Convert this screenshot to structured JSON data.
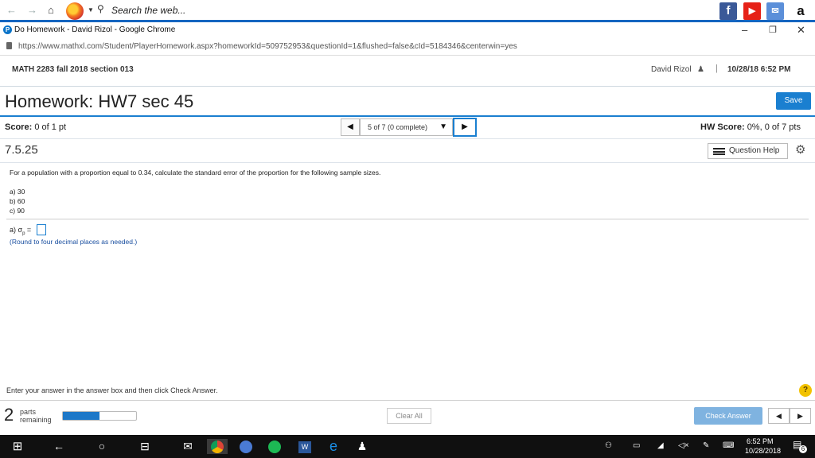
{
  "browser": {
    "search_placeholder": "Search the web...",
    "window_title": "Do Homework - David Rizol - Google Chrome",
    "url": "https://www.mathxl.com/Student/PlayerHomework.aspx?homeworkId=509752953&questionId=1&flushed=false&cId=5184346&centerwin=yes",
    "win_minimize": "–",
    "win_restore": "❐",
    "win_close": "✕"
  },
  "course": {
    "name": "MATH 2283 fall 2018 section 013",
    "user": "David Rizol",
    "separator": "|",
    "datetime": "10/28/18 6:52 PM"
  },
  "homework": {
    "title": "Homework: HW7 sec 45",
    "save_label": "Save",
    "score_label": "Score:",
    "score_value": "0 of 1 pt",
    "question_nav": "5 of 7 (0 complete)",
    "hw_score_label": "HW Score:",
    "hw_score_value": "0%, 0 of 7 pts",
    "question_id": "7.5.25",
    "help_label": "Question Help"
  },
  "question": {
    "text": "For a population with a proportion equal to 0.34, calculate the standard error of the proportion for the following sample sizes.",
    "items": [
      "a) 30",
      "b) 60",
      "c) 90"
    ],
    "answer_prefix": "a) σ",
    "answer_sub": "p",
    "answer_eq": " =",
    "note": "(Round to four decimal places as needed.)"
  },
  "footer": {
    "instruction": "Enter your answer in the answer box and then click Check Answer.",
    "parts_count": "2",
    "parts_label_1": "parts",
    "parts_label_2": "remaining",
    "progress_fraction": 0.5,
    "clear_label": "Clear All",
    "check_label": "Check Answer"
  },
  "taskbar": {
    "time": "6:52 PM",
    "date": "10/28/2018",
    "notification_count": "6"
  },
  "colors": {
    "accent": "#1a7fd0",
    "progress": "#1d78c8",
    "check_button": "#7fb3e0",
    "help": "#f2c200"
  }
}
